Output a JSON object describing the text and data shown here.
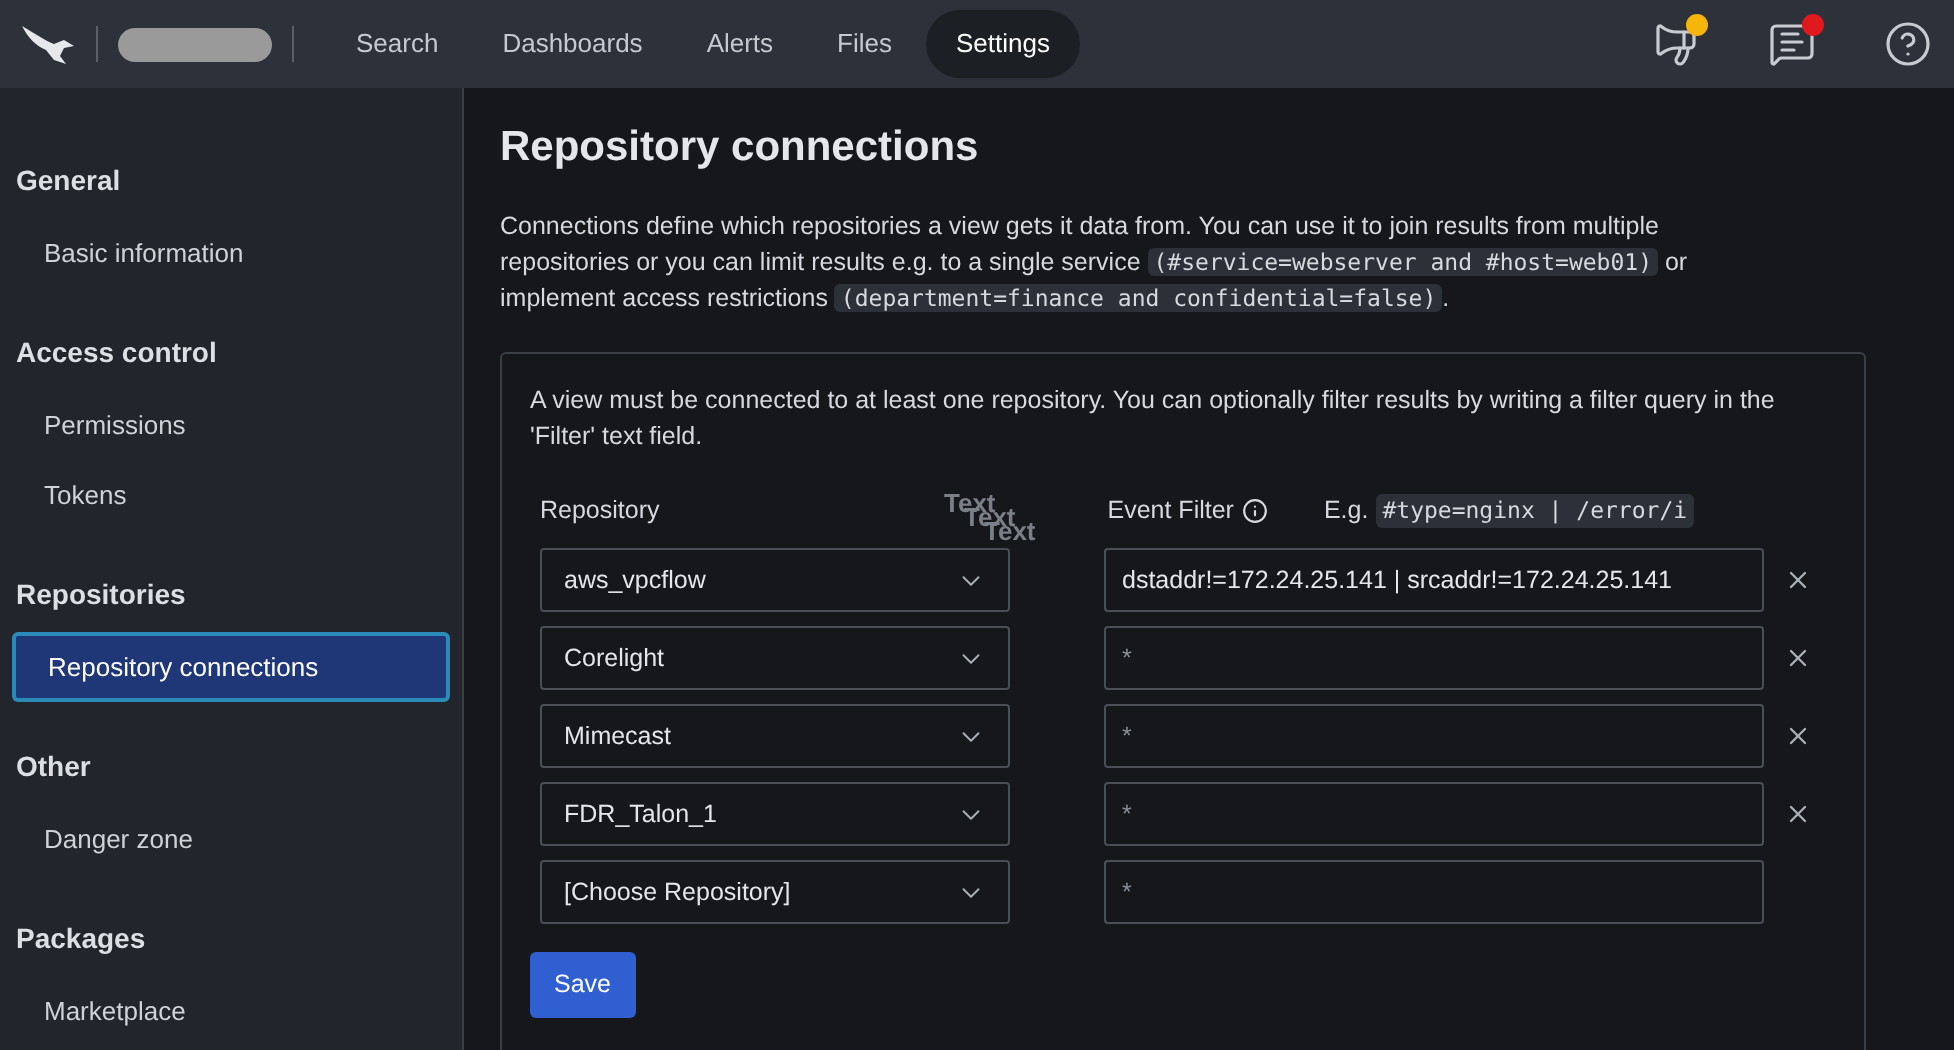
{
  "nav": {
    "tabs": [
      {
        "label": "Search",
        "selected": false
      },
      {
        "label": "Dashboards",
        "selected": false
      },
      {
        "label": "Alerts",
        "selected": false
      },
      {
        "label": "Files",
        "selected": false
      },
      {
        "label": "Settings",
        "selected": true
      }
    ],
    "notifications": [
      {
        "kind": "announcements",
        "color": "#f5b50a"
      },
      {
        "kind": "messages",
        "color": "#e0191f"
      },
      {
        "kind": "help"
      }
    ]
  },
  "sidebar": {
    "sections": [
      {
        "title": "General",
        "items": [
          {
            "label": "Basic information",
            "selected": false
          }
        ]
      },
      {
        "title": "Access control",
        "items": [
          {
            "label": "Permissions",
            "selected": false
          },
          {
            "label": "Tokens",
            "selected": false
          }
        ]
      },
      {
        "title": "Repositories",
        "items": [
          {
            "label": "Repository connections",
            "selected": true
          }
        ]
      },
      {
        "title": "Other",
        "items": [
          {
            "label": "Danger zone",
            "selected": false
          }
        ]
      },
      {
        "title": "Packages",
        "items": [
          {
            "label": "Marketplace",
            "selected": false
          }
        ]
      }
    ]
  },
  "page": {
    "title": "Repository connections",
    "intro": [
      {
        "kind": "text",
        "text": "Connections define which repositories a view gets it data from. You can use it to join results from multiple repositories or you can limit results e.g. to a single service "
      },
      {
        "kind": "code",
        "text": "(#service=webserver and #host=web01)"
      },
      {
        "kind": "text",
        "text": " or implement access restrictions "
      },
      {
        "kind": "code",
        "text": "(department=finance and confidential=false)"
      },
      {
        "kind": "text",
        "text": "."
      }
    ],
    "card": {
      "note": "A view must be connected to at least one repository. You can optionally filter results by writing a filter query in the 'Filter' text field.",
      "repository_header": "Repository",
      "filter_header": "Event Filter",
      "example_label": "E.g.",
      "example_code": "#type=nginx | /error/i",
      "stray_labels": [
        "Text",
        "Text",
        "Text"
      ],
      "rows": [
        {
          "repository": "aws_vpcflow",
          "filter": "dstaddr!=172.24.25.141 | srcaddr!=172.24.25.141",
          "removable": true
        },
        {
          "repository": "Corelight",
          "placeholder": "*",
          "removable": true
        },
        {
          "repository": "Mimecast",
          "placeholder": "*",
          "removable": true
        },
        {
          "repository": "FDR_Talon_1",
          "placeholder": "*",
          "removable": true
        },
        {
          "repository": "[Choose Repository]",
          "placeholder": "*",
          "removable": false
        }
      ],
      "save_button": "Save"
    }
  }
}
